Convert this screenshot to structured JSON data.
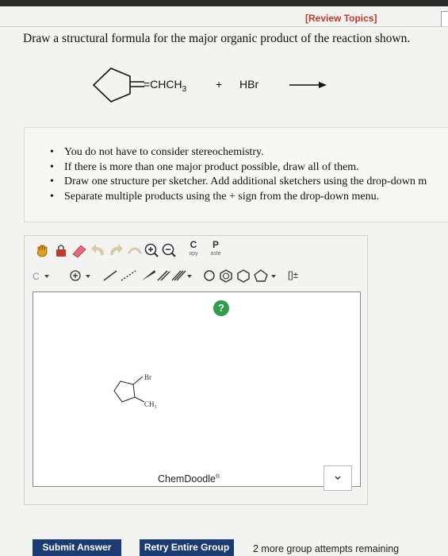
{
  "header": {
    "review_link": "[Review Topics]"
  },
  "question": {
    "text": "Draw a structural formula for the major organic product of the reaction shown."
  },
  "reaction": {
    "substituent": "=CHCH",
    "subscript": "3",
    "plus": "+",
    "reagent": "HBr"
  },
  "instructions": [
    "You do not have to consider stereochemistry.",
    "If there is more than one major product possible, draw all of them.",
    "Draw one structure per sketcher. Add additional sketchers using the drop-down m",
    "Separate multiple products using the + sign from the drop-down menu."
  ],
  "toolbar": {
    "copy_label": "C",
    "copy_sub": "opy",
    "paste_label": "P",
    "paste_sub": "aste",
    "clean_label": "C",
    "charge_label": "[]±"
  },
  "sketcher": {
    "help_label": "?",
    "watermark": "ChemDoodle",
    "watermark_mark": "®",
    "structure": {
      "atom1": "Br",
      "atom2": "CH",
      "atom2_sub": "3"
    }
  },
  "footer": {
    "submit_label": "Submit Answer",
    "retry_label": "Retry Entire Group",
    "attempts_text": "2 more group attempts remaining"
  },
  "colors": {
    "button": "#1b3b73",
    "review_link": "#c0392b",
    "help": "#2e9e4a"
  }
}
